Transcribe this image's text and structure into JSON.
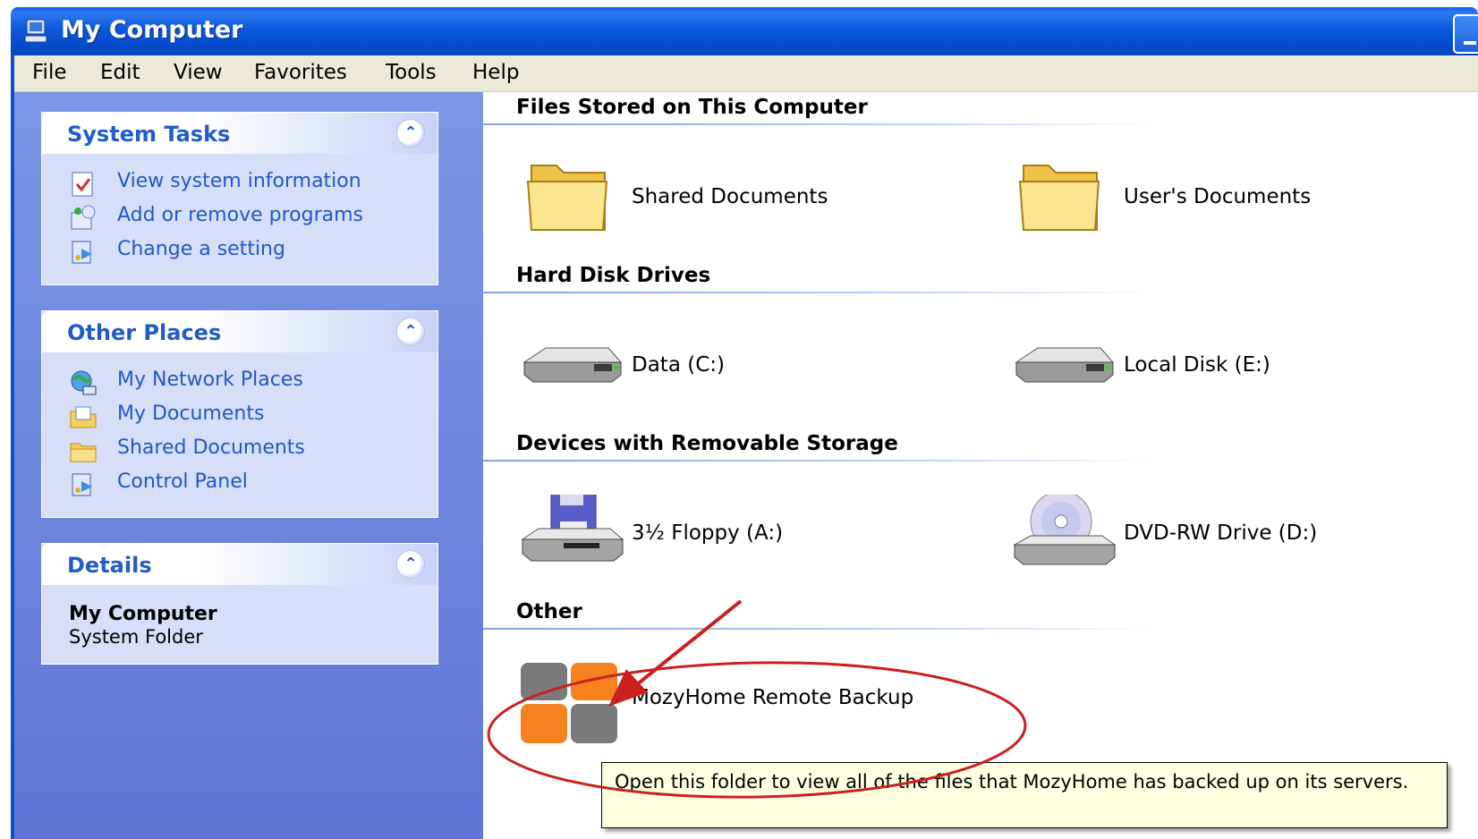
{
  "window": {
    "title": "My Computer"
  },
  "menu": [
    "File",
    "Edit",
    "View",
    "Favorites",
    "Tools",
    "Help"
  ],
  "left_pane": {
    "system_tasks": {
      "title": "System Tasks",
      "items": [
        "View system information",
        "Add or remove programs",
        "Change a setting"
      ]
    },
    "other_places": {
      "title": "Other Places",
      "items": [
        "My Network Places",
        "My Documents",
        "Shared Documents",
        "Control Panel"
      ]
    },
    "details": {
      "title": "Details",
      "name": "My Computer",
      "type": "System Folder"
    },
    "collapse_glyph": "⌃"
  },
  "sections": {
    "files_stored": {
      "title": "Files Stored on This Computer",
      "items": [
        "Shared Documents",
        "User's Documents"
      ]
    },
    "hard_disks": {
      "title": "Hard Disk Drives",
      "items": [
        "Data (C:)",
        "Local Disk (E:)"
      ]
    },
    "removable": {
      "title": "Devices with Removable Storage",
      "items": [
        "3½ Floppy (A:)",
        "DVD-RW Drive (D:)"
      ]
    },
    "other": {
      "title": "Other",
      "items": [
        "MozyHome Remote Backup"
      ]
    }
  },
  "tooltip": "Open this folder to view all of the files that MozyHome has backed up on its servers.",
  "colors": {
    "title_bar": "#0a58dc",
    "left_pane": "#6f86de",
    "link": "#2157c6",
    "tooltip_bg": "#ffffe1",
    "annotation": "#cc1f1f",
    "mozy_orange": "#f58220",
    "mozy_gray": "#7a7a7a"
  }
}
